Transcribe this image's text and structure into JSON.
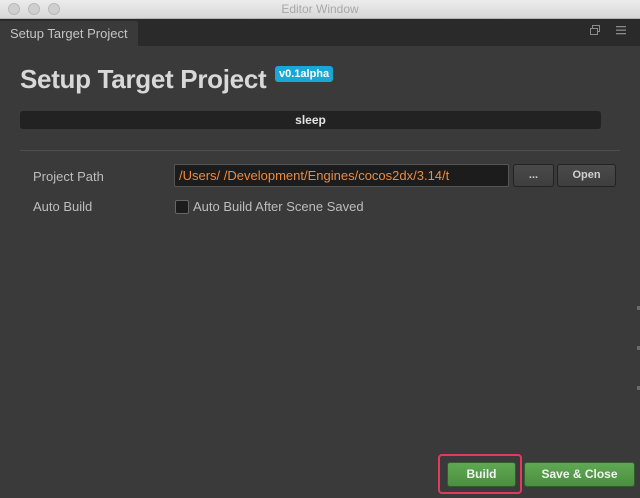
{
  "window": {
    "title": "Editor Window"
  },
  "tab": {
    "label": "Setup Target Project",
    "controls": [
      "restore-icon",
      "menu-icon"
    ]
  },
  "header": {
    "title": "Setup Target Project",
    "version_badge": "v0.1alpha"
  },
  "status": {
    "text": "sleep"
  },
  "project_path": {
    "label": "Project Path",
    "value": "/Users/         /Development/Engines/cocos2dx/3.14/t",
    "browse_label": "...",
    "open_label": "Open"
  },
  "auto_build": {
    "label": "Auto Build",
    "checkbox_label": "Auto Build After Scene Saved",
    "checked": false
  },
  "footer": {
    "build_label": "Build",
    "save_close_label": "Save & Close"
  },
  "colors": {
    "background": "#3a3a3a",
    "accent_badge": "#1aa7d8",
    "path_text": "#f08a3e",
    "button_green": "#5fa852",
    "highlight": "#e23a5d"
  }
}
